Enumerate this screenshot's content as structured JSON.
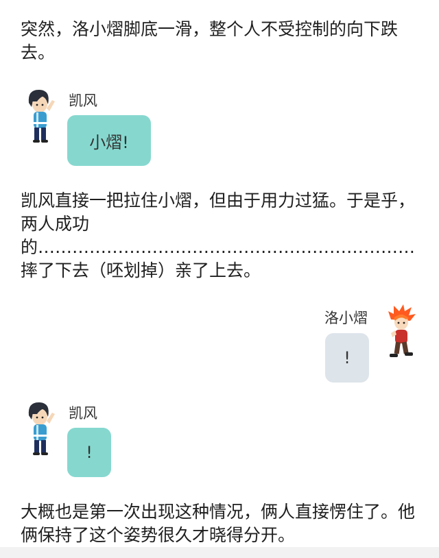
{
  "narration": [
    "突然，洛小熠脚底一滑，整个人不受控制的向下跌去。",
    "凯风直接一把拉住小熠，但由于用力过猛。于是乎，两人成功的…………………………………………………………摔了下去（呸划掉）亲了上去。",
    "大概也是第一次出现这种情况，俩人直接愣住了。他俩保持了这个姿势很久才晓得分开。"
  ],
  "messages": [
    {
      "speaker": "凯风",
      "text": "小熠!",
      "side": "left",
      "avatar_icon": "kaifeng-avatar-icon"
    },
    {
      "speaker": "洛小熠",
      "text": "!",
      "side": "right",
      "avatar_icon": "luoxiaoyi-avatar-icon"
    },
    {
      "speaker": "凯风",
      "text": "!",
      "side": "left",
      "avatar_icon": "kaifeng-avatar-icon"
    }
  ],
  "colors": {
    "left_bubble": "#86d8cf",
    "right_bubble": "#dde4ea"
  }
}
